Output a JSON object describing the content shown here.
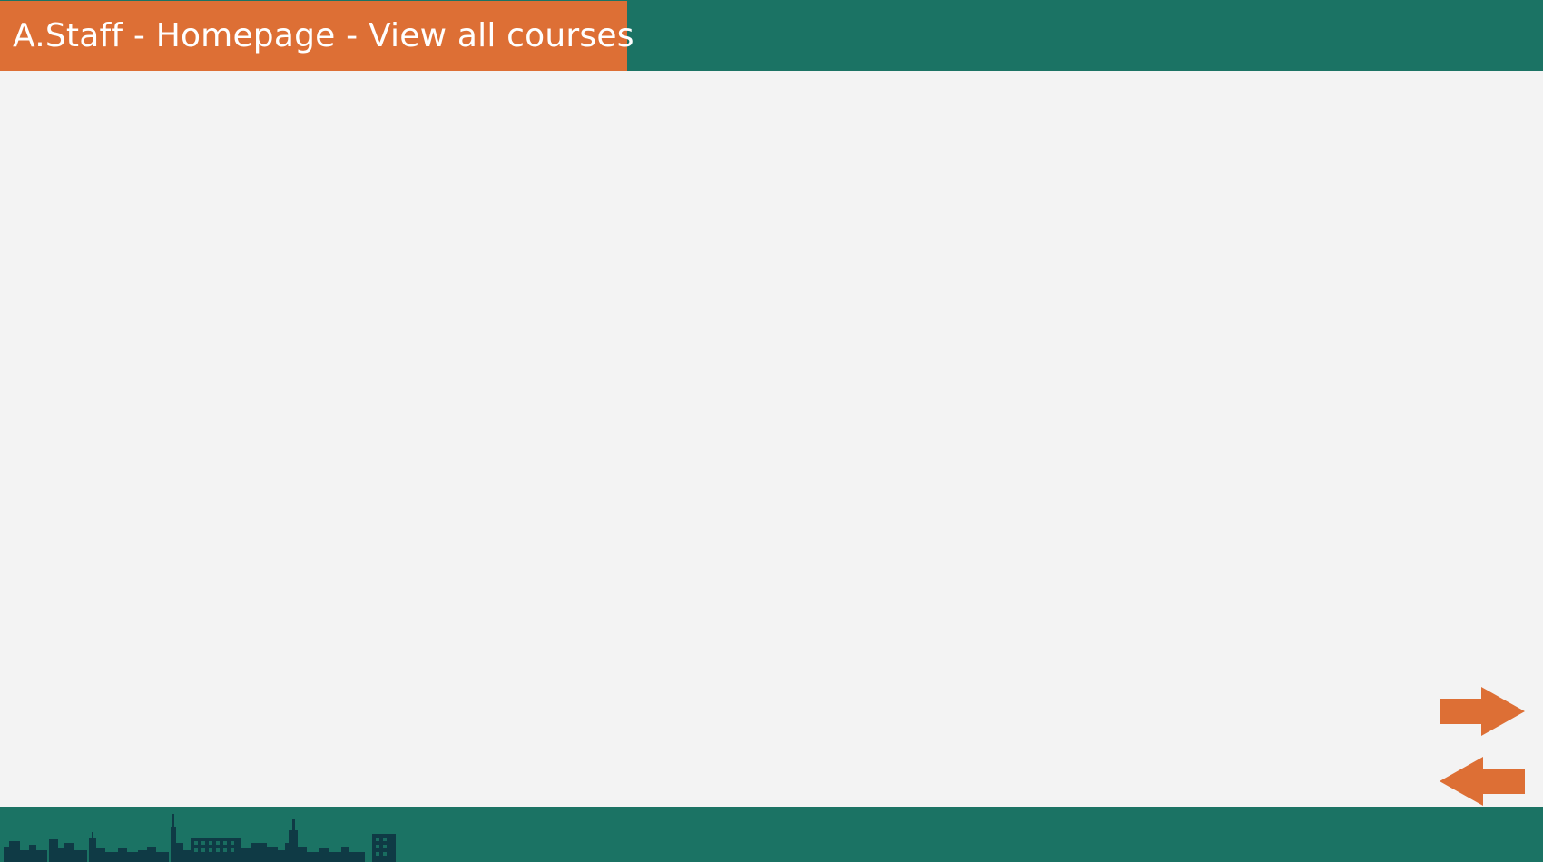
{
  "header": {
    "title": "A.Staff - Homepage - View all courses"
  },
  "navigation": {
    "next_icon": "arrow-right-icon",
    "prev_icon": "arrow-left-icon"
  },
  "footer": {
    "decoration_icon": "city-skyline-icon"
  },
  "colors": {
    "primary_teal": "#1b7364",
    "accent_orange": "#dd6f35",
    "background": "#f3f3f3",
    "skyline": "#0f3a45"
  }
}
